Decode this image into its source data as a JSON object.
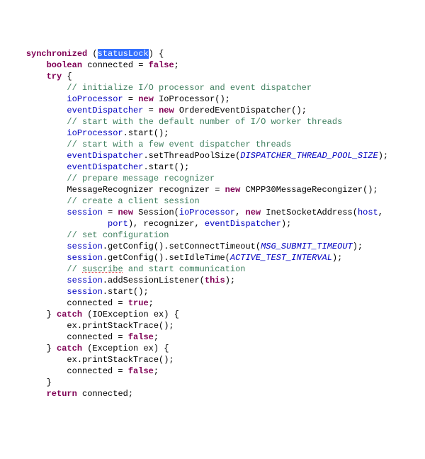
{
  "code": {
    "sync": "synchronized",
    "statusLock": "statusLock",
    "boolean": "boolean",
    "connectedDecl": " connected = ",
    "false": "false",
    "true": "true",
    "try": "try",
    "catch": "catch",
    "new": "new",
    "return": "return",
    "this": "this",
    "c1": "// initialize I/O processor and event dispatcher",
    "c2": "// start with the default number of I/O worker threads",
    "c3": "// start with a few event dispatcher threads",
    "c4": "// prepare message recognizer",
    "c5": "// create a client session",
    "c6": "// set configuration",
    "c7a": "// ",
    "c7b": "suscribe",
    "c7c": " and start communication",
    "ioProcessor": "ioProcessor",
    "eventDispatcher": "eventDispatcher",
    "session": "session",
    "IoProcessor": " IoProcessor();",
    "OrderedEventDispatcher": " OrderedEventDispatcher();",
    "startCall": ".start();",
    "setTPSa": ".setThreadPoolSize(",
    "setTPSb": ");",
    "DISPATCHER_THREAD_POOL_SIZE": "DISPATCHER_THREAD_POOL_SIZE",
    "MessageRecognizerLine": "MessageRecognizer recognizer = ",
    "CMPP30": " CMPP30MessageRecongizer();",
    "sessionNewA": " Session(",
    "sessionNewB": ", ",
    "InetSocketAddressA": " InetSocketAddress(",
    "host": "host",
    "comma": ",",
    "port": "port",
    "sessionNewC": "), recognizer, ",
    "sessionNewD": ");",
    "setConnectTimeoutA": ".getConfig().setConnectTimeout(",
    "MSG_SUBMIT_TIMEOUT": "MSG_SUBMIT_TIMEOUT",
    "closeParen": ");",
    "setIdleTimeA": ".getConfig().setIdleTime(",
    "ACTIVE_TEST_INTERVAL": "ACTIVE_TEST_INTERVAL",
    "addSessionListenerA": ".addSessionListener(",
    "catchIOE": " (IOException ex) {",
    "catchE": " (Exception ex) {",
    "printStack": "ex.printStackTrace();",
    "connectedFalse": "connected = ",
    "connectedTrue": "connected = ",
    "returnConnected": " connected;"
  }
}
